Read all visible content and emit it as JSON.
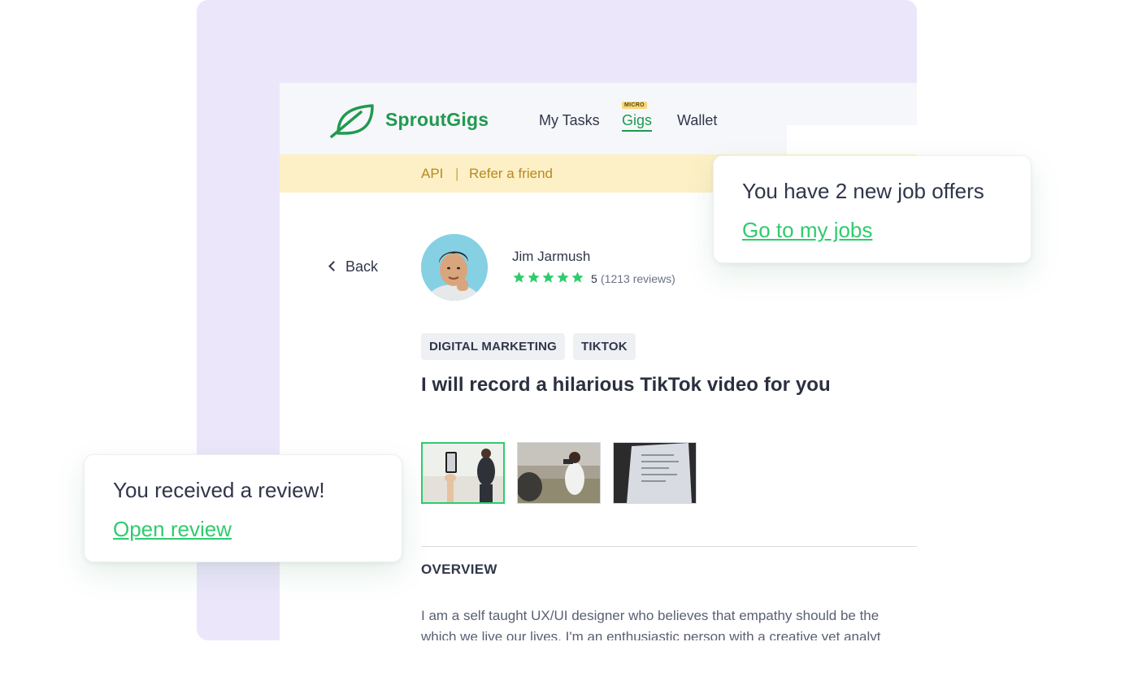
{
  "app": {
    "brand": "SproutGigs"
  },
  "nav": {
    "my_tasks": "My Tasks",
    "gigs": "Gigs",
    "gigs_badge": "MICRO",
    "wallet": "Wallet"
  },
  "subnav": {
    "api": "API",
    "separator": "|",
    "refer": "Refer a friend"
  },
  "back": {
    "label": "Back"
  },
  "seller": {
    "name": "Jim Jarmush",
    "rating": "5",
    "rating_max": 5,
    "reviews": "(1213 reviews)"
  },
  "gig": {
    "tags": [
      "DIGITAL MARKETING",
      "TIKTOK"
    ],
    "title": "I will record a hilarious TikTok video for you",
    "thumbnails": [
      "thumbnail-1",
      "thumbnail-2",
      "thumbnail-3"
    ],
    "selected_thumbnail": 0
  },
  "overview": {
    "heading": "OVERVIEW",
    "lines": [
      "I am a self taught UX/UI designer who believes that empathy should be the",
      "which we live our lives. I'm an enthusiastic person with a creative yet analyt"
    ]
  },
  "notifications": {
    "offers_text": "You have 2 new job offers",
    "offers_link": "Go to my jobs",
    "review_text": "You received a review!",
    "review_link": "Open review"
  },
  "colors": {
    "brand_green": "#1f9a4f",
    "link_green": "#2ecc6d",
    "subnav_bg": "#fdf0c6",
    "panel_purple": "#ece6fb",
    "star_green": "#2ecc6d"
  },
  "icons": {
    "logo": "leaf-logo-icon",
    "back": "chevron-left-icon",
    "star": "star-icon"
  }
}
